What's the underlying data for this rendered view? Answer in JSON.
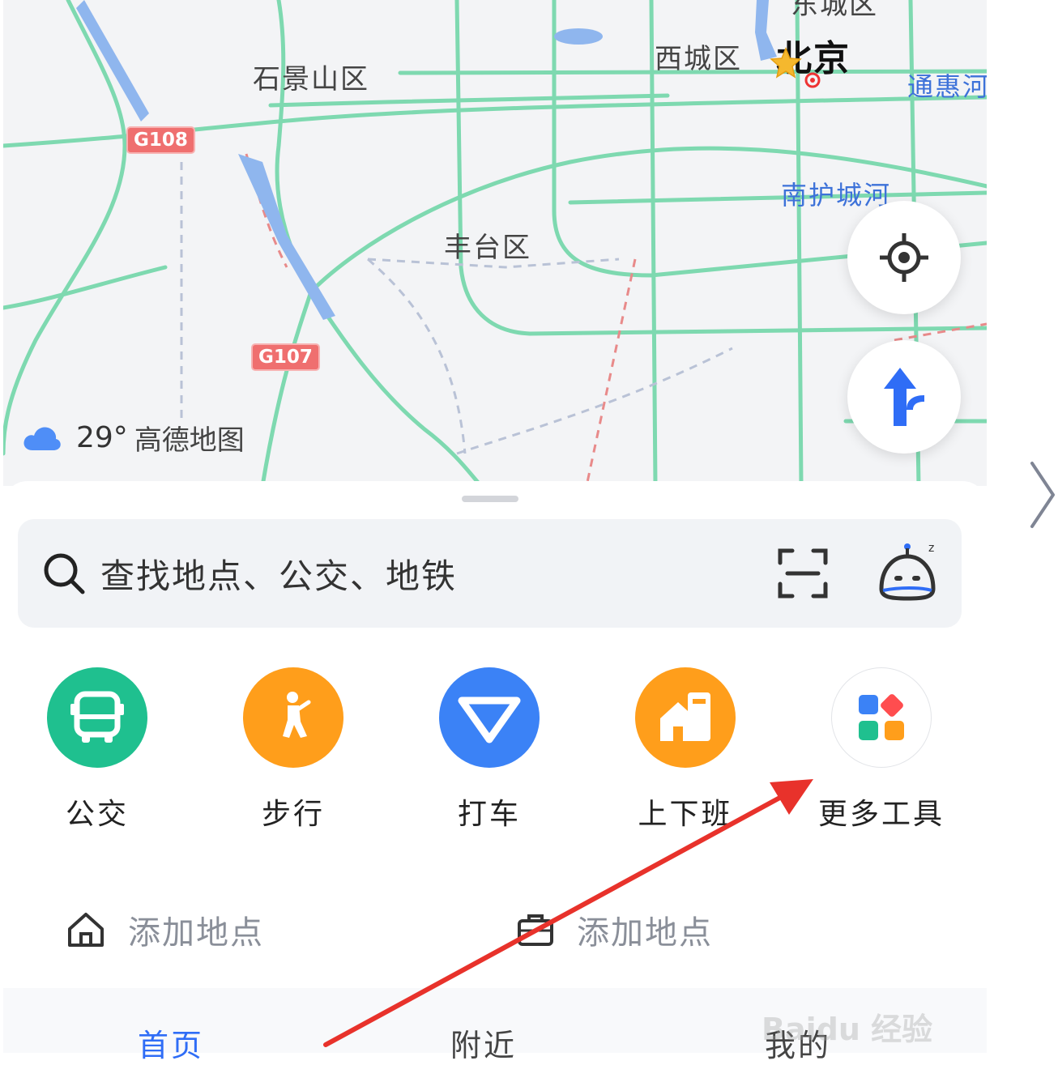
{
  "map": {
    "labels": {
      "shijingshan": "石景山区",
      "xicheng": "西城区",
      "beijing": "北京",
      "fengtai": "丰台区",
      "dongcheng": "东城区",
      "tonghui": "通惠河",
      "nanhu": "南护城河"
    },
    "badges": {
      "g108": "G108",
      "g107": "G107"
    },
    "weather": {
      "temp": "29°",
      "brand": "高德地图",
      "icon": "cloud-icon"
    }
  },
  "search": {
    "placeholder": "查找地点、公交、地铁"
  },
  "tools": [
    {
      "label": "公交",
      "color": "#1fc08f"
    },
    {
      "label": "步行",
      "color": "#ff9e1b"
    },
    {
      "label": "打车",
      "color": "#3b82f6"
    },
    {
      "label": "上下班",
      "color": "#ff9e1b"
    },
    {
      "label": "更多工具",
      "color": "#ffffff"
    }
  ],
  "places": {
    "home": "添加地点",
    "work": "添加地点"
  },
  "tabs": {
    "home": "首页",
    "nearby": "附近",
    "mine": "我的"
  },
  "watermark": "Baidu 经验",
  "colors": {
    "accent": "#2f6df6",
    "road": "#7ed9b0",
    "annotation_arrow": "#e8322b"
  }
}
